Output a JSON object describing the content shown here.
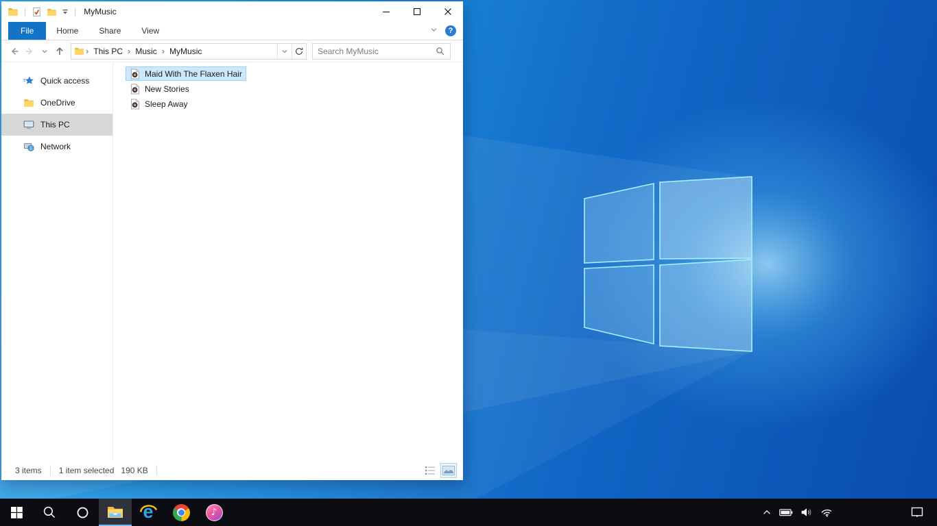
{
  "colors": {
    "accent_blue": "#1374c6",
    "file_selection_fill": "#cce8ff",
    "file_selection_border": "#99d1ff",
    "sidebar_selected_bg": "#d7d7d7",
    "taskbar_bg": "#0c0d12",
    "taskbar_active_underline": "#76b9ed",
    "wallpaper_light": "#31a9ec",
    "wallpaper_dark": "#0a4cb0",
    "help_icon_bg": "#2b7cd3"
  },
  "window": {
    "title": "MyMusic",
    "quick_access_toolbar": {
      "separator": "|",
      "icons": [
        "explorer-folder-icon",
        "properties-icon",
        "new-folder-icon",
        "customize-quick-access-chevron"
      ]
    },
    "controls": [
      "minimize",
      "maximize",
      "close"
    ],
    "ribbon": {
      "tabs": [
        {
          "label": "File",
          "active": true
        },
        {
          "label": "Home",
          "active": false
        },
        {
          "label": "Share",
          "active": false
        },
        {
          "label": "View",
          "active": false
        }
      ],
      "collapse_icon": "chevron-down-icon",
      "help_glyph": "?"
    },
    "navigation": {
      "breadcrumb": [
        "This PC",
        "Music",
        "MyMusic"
      ],
      "breadcrumb_separator": "›",
      "search_placeholder": "Search MyMusic",
      "icons": [
        "back-arrow",
        "forward-arrow",
        "recent-locations-chevron",
        "up-arrow",
        "address-dropdown-chevron",
        "refresh",
        "search-magnifier"
      ]
    },
    "sidebar": {
      "items": [
        {
          "label": "Quick access",
          "icon": "quick-access-star",
          "selected": false
        },
        {
          "label": "OneDrive",
          "icon": "onedrive-folder",
          "selected": false
        },
        {
          "label": "This PC",
          "icon": "this-pc-monitor",
          "selected": true
        },
        {
          "label": "Network",
          "icon": "network-computer",
          "selected": false
        }
      ]
    },
    "file_list": {
      "items": [
        {
          "name": "Maid With The Flaxen Hair",
          "icon": "audio-file",
          "selected": true
        },
        {
          "name": "New Stories",
          "icon": "audio-file",
          "selected": false
        },
        {
          "name": "Sleep Away",
          "icon": "audio-file",
          "selected": false
        }
      ]
    },
    "status_bar": {
      "items_count": "3 items",
      "selection_count": "1 item selected",
      "selection_size": "190 KB",
      "view_buttons": [
        "details-view",
        "large-thumbnails-view"
      ],
      "active_view": "large-thumbnails-view"
    }
  },
  "taskbar": {
    "buttons": [
      {
        "name": "start",
        "icon": "windows-logo"
      },
      {
        "name": "search",
        "icon": "magnifier"
      },
      {
        "name": "cortana",
        "icon": "circle-ring"
      },
      {
        "name": "file-explorer",
        "icon": "yellow-folder",
        "active": true
      },
      {
        "name": "internet-explorer",
        "icon": "blue-e-with-halo"
      },
      {
        "name": "chrome",
        "icon": "chrome-wheel"
      },
      {
        "name": "itunes",
        "icon": "music-note-pink-circle"
      }
    ],
    "glyphs": {
      "ie": "e",
      "itunes_note": "♪"
    },
    "tray_icons": [
      "hidden-icons-chevron",
      "battery",
      "volume",
      "wifi"
    ],
    "action_center_icon": "action-center-bubble"
  }
}
